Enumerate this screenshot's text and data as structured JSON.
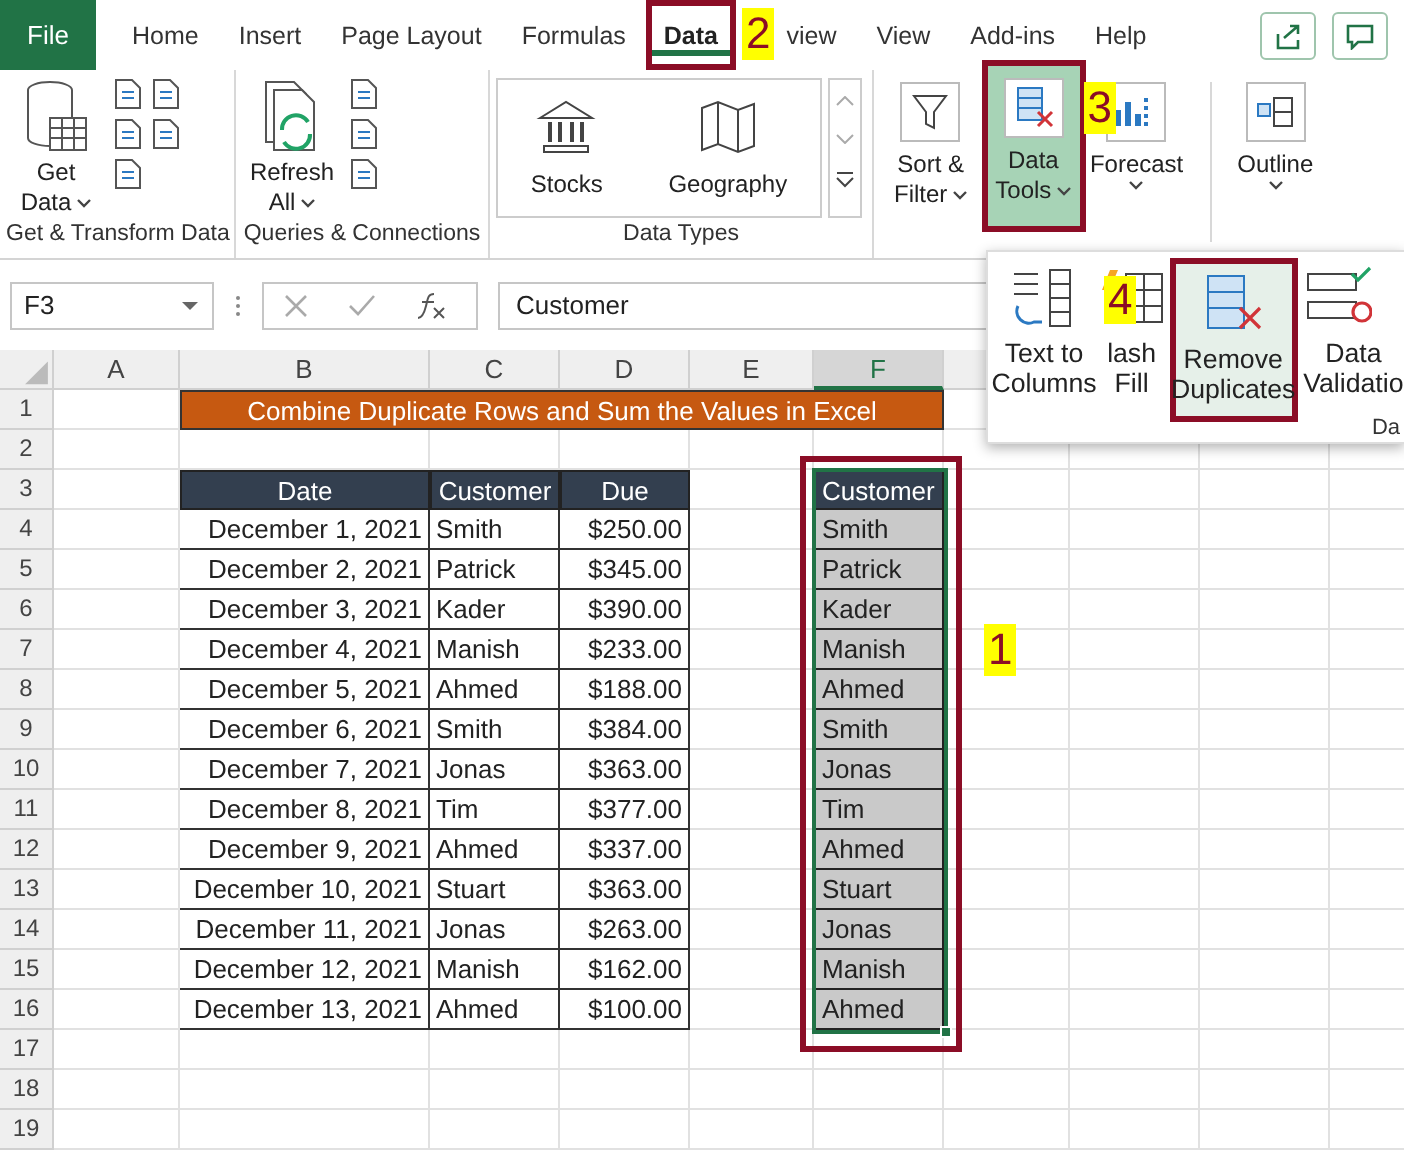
{
  "tabs": {
    "file": "File",
    "items": [
      {
        "label": "Home",
        "selected": false
      },
      {
        "label": "Insert",
        "selected": false
      },
      {
        "label": "Page Layout",
        "selected": false
      },
      {
        "label": "Formulas",
        "selected": false
      },
      {
        "label": "Data",
        "selected": true
      },
      {
        "label": "view",
        "selected": false
      },
      {
        "label": "View",
        "selected": false
      },
      {
        "label": "Add-ins",
        "selected": false
      },
      {
        "label": "Help",
        "selected": false
      }
    ]
  },
  "ribbon": {
    "groups": [
      {
        "kind": "get",
        "label": "Get & Transform Data",
        "button": [
          "Get",
          "Data"
        ]
      },
      {
        "kind": "queries",
        "label": "Queries & Connections",
        "button": [
          "Refresh",
          "All"
        ]
      },
      {
        "kind": "types",
        "label": "Data Types",
        "items": [
          "Stocks",
          "Geography"
        ]
      },
      {
        "kind": "tools",
        "buttons": [
          {
            "kind": "filter",
            "lines": [
              "Sort &",
              "Filter"
            ],
            "selected": false
          },
          {
            "kind": "datatools",
            "lines": [
              "Data",
              "Tools"
            ],
            "selected": true
          },
          {
            "kind": "forecast",
            "lines": [
              "Forecast"
            ],
            "selected": false
          },
          {
            "kind": "outline",
            "lines": [
              "Outline"
            ],
            "selected": false
          }
        ]
      }
    ]
  },
  "dropdown": {
    "items": [
      {
        "kind": "text-to-columns",
        "lines": [
          "Text to",
          "Columns"
        ],
        "selected": false
      },
      {
        "kind": "flash-fill",
        "lines": [
          "lash",
          "Fill"
        ],
        "selected": false
      },
      {
        "kind": "remove-duplicates",
        "lines": [
          "Remove",
          "Duplicates"
        ],
        "selected": true
      },
      {
        "kind": "validation",
        "lines": [
          "Data",
          "Validatio"
        ],
        "selected": false
      }
    ],
    "group_label": "Da"
  },
  "formula_bar": {
    "name_box": "F3",
    "formula": "Customer"
  },
  "sheet": {
    "columns": [
      {
        "label": "A",
        "selected": false
      },
      {
        "label": "B",
        "selected": false
      },
      {
        "label": "C",
        "selected": false
      },
      {
        "label": "D",
        "selected": false
      },
      {
        "label": "E",
        "selected": false
      },
      {
        "label": "F",
        "selected": true
      }
    ],
    "row_numbers": [
      "1",
      "2",
      "3",
      "4",
      "5",
      "6",
      "7",
      "8",
      "9",
      "10",
      "11",
      "12",
      "13",
      "14",
      "15",
      "16",
      "17",
      "18",
      "19"
    ],
    "title": "Combine Duplicate Rows and Sum the Values in Excel",
    "table": {
      "columns": [
        "Date",
        "Customer",
        "Due"
      ],
      "rows": [
        [
          "December 1, 2021",
          "Smith",
          "$250.00"
        ],
        [
          "December 2, 2021",
          "Patrick",
          "$345.00"
        ],
        [
          "December 3, 2021",
          "Kader",
          "$390.00"
        ],
        [
          "December 4, 2021",
          "Manish",
          "$233.00"
        ],
        [
          "December 5, 2021",
          "Ahmed",
          "$188.00"
        ],
        [
          "December 6, 2021",
          "Smith",
          "$384.00"
        ],
        [
          "December 7, 2021",
          "Jonas",
          "$363.00"
        ],
        [
          "December 8, 2021",
          "Tim",
          "$377.00"
        ],
        [
          "December 9, 2021",
          "Ahmed",
          "$337.00"
        ],
        [
          "December 10, 2021",
          "Stuart",
          "$363.00"
        ],
        [
          "December 11, 2021",
          "Jonas",
          "$263.00"
        ],
        [
          "December 12, 2021",
          "Manish",
          "$162.00"
        ],
        [
          "December 13, 2021",
          "Ahmed",
          "$100.00"
        ]
      ]
    },
    "copy": {
      "header": "Customer",
      "values": [
        "Smith",
        "Patrick",
        "Kader",
        "Manish",
        "Ahmed",
        "Smith",
        "Jonas",
        "Tim",
        "Ahmed",
        "Stuart",
        "Jonas",
        "Manish",
        "Ahmed"
      ]
    }
  },
  "steps": [
    "2",
    "3",
    "4",
    "1"
  ]
}
